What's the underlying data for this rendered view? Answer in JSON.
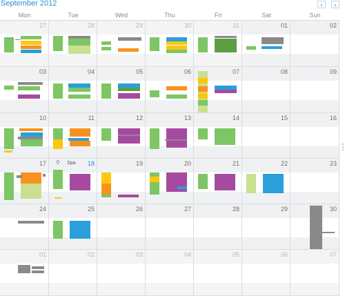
{
  "header": {
    "month_title": "September 2012",
    "prev_glyph": "‹",
    "next_glyph": "›"
  },
  "weekdays": [
    "Mon",
    "Tue",
    "Wed",
    "Thu",
    "Fri",
    "Sat",
    "Sun"
  ],
  "colors": {
    "green": "#7ec565",
    "orange": "#f7921e",
    "yellow": "#fcc80f",
    "blue": "#2a9fda",
    "purple": "#a54aa0",
    "gray": "#8a8a8a",
    "lightgreen": "#c8e090",
    "darkgreen": "#5c9f43",
    "accent": "#2b8ed6"
  },
  "weeks": [
    [
      {
        "day": "27",
        "other": true
      },
      {
        "day": "28",
        "other": true
      },
      {
        "day": "29",
        "other": true
      },
      {
        "day": "30",
        "other": true
      },
      {
        "day": "31",
        "other": true
      },
      {
        "day": "01"
      },
      {
        "day": "02"
      }
    ],
    [
      {
        "day": "03"
      },
      {
        "day": "04"
      },
      {
        "day": "05"
      },
      {
        "day": "06"
      },
      {
        "day": "07"
      },
      {
        "day": "08"
      },
      {
        "day": "09"
      }
    ],
    [
      {
        "day": "10"
      },
      {
        "day": "11"
      },
      {
        "day": "12"
      },
      {
        "day": "13"
      },
      {
        "day": "14"
      },
      {
        "day": "15"
      },
      {
        "day": "16"
      }
    ],
    [
      {
        "day": "17"
      },
      {
        "day": "18",
        "today": true,
        "label": "Spa"
      },
      {
        "day": "19"
      },
      {
        "day": "20"
      },
      {
        "day": "21"
      },
      {
        "day": "22"
      },
      {
        "day": "23"
      }
    ],
    [
      {
        "day": "24"
      },
      {
        "day": "25"
      },
      {
        "day": "26"
      },
      {
        "day": "27"
      },
      {
        "day": "28"
      },
      {
        "day": "29"
      },
      {
        "day": "30"
      }
    ],
    [
      {
        "day": "01",
        "other": true
      },
      {
        "day": "02",
        "other": true
      },
      {
        "day": "03",
        "other": true
      },
      {
        "day": "04",
        "other": true
      },
      {
        "day": "05",
        "other": true
      },
      {
        "day": "06",
        "other": true
      },
      {
        "day": "07",
        "other": true
      }
    ]
  ]
}
